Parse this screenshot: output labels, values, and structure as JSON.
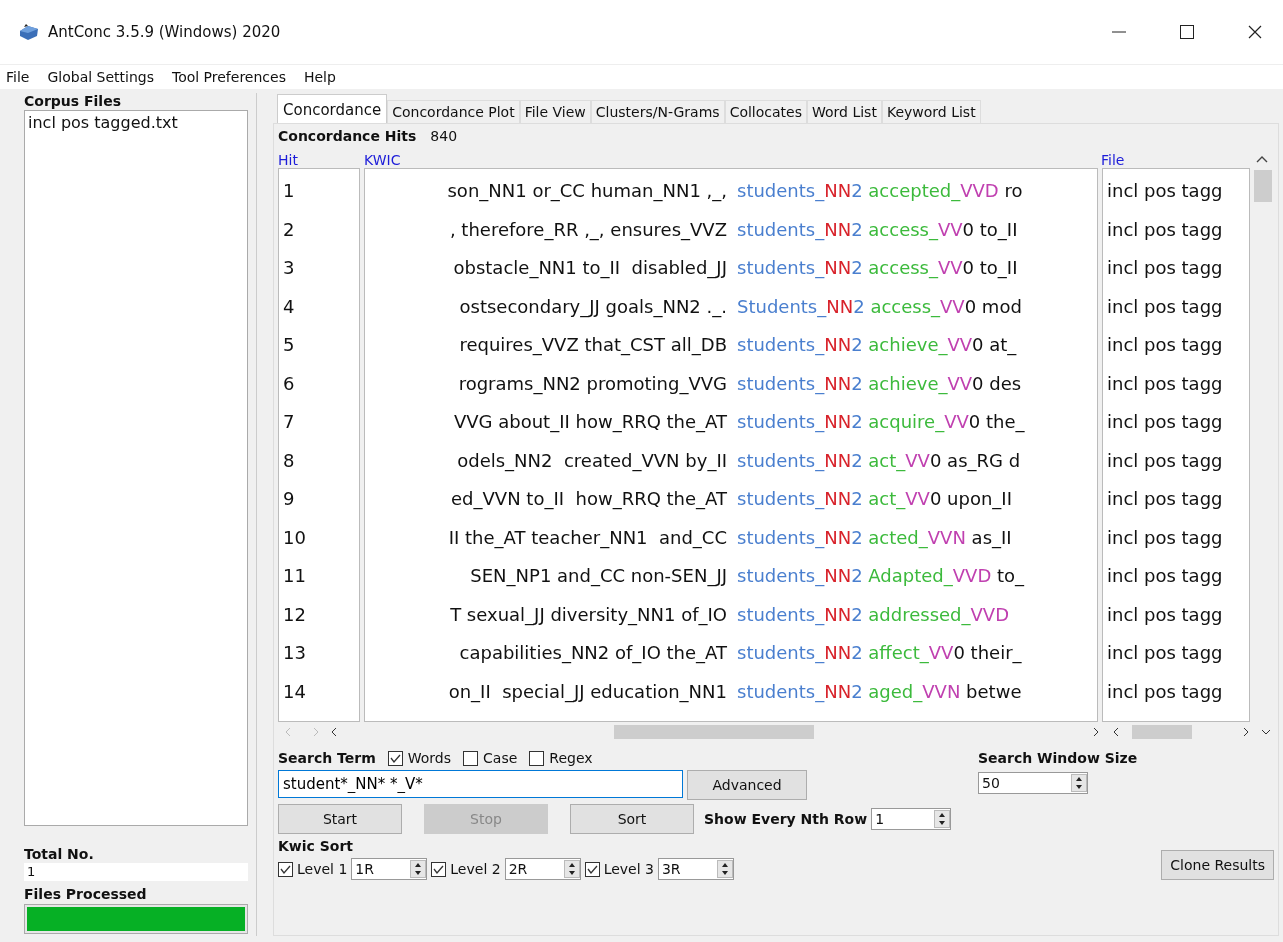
{
  "window": {
    "title": "AntConc 3.5.9 (Windows) 2020"
  },
  "menu": [
    "File",
    "Global Settings",
    "Tool Preferences",
    "Help"
  ],
  "sidebar": {
    "title": "Corpus Files",
    "files": [
      {
        "name": "incl pos tagged.txt",
        "selected": false
      }
    ],
    "total_label": "Total No.",
    "total_value": "1",
    "processed_label": "Files Processed",
    "progress": {
      "level": 1
    }
  },
  "tabs": [
    {
      "label": "Concordance",
      "selected": true
    },
    {
      "label": "Concordance Plot",
      "selected": false
    },
    {
      "label": "File View",
      "selected": false
    },
    {
      "label": "Clusters/N-Grams",
      "selected": false
    },
    {
      "label": "Collocates",
      "selected": false
    },
    {
      "label": "Word List",
      "selected": false
    },
    {
      "label": "Keyword List",
      "selected": false
    }
  ],
  "hits": {
    "label": "Concordance Hits",
    "count": "840"
  },
  "table": {
    "columns": [
      "Hit",
      "KWIC",
      "File"
    ],
    "rows": [
      {
        "hit": "1",
        "left": "son_NN1 or_CC human_NN1 ,_,",
        "node_word": "students_",
        "node_tag": "NN",
        "node_rest": "2",
        "verb_word": "accepted_",
        "verb_tag": "VVD",
        "right": " ro",
        "file": "incl pos tagg"
      },
      {
        "hit": "2",
        "left": ", therefore_RR ,_, ensures_VVZ",
        "node_word": "students_",
        "node_tag": "NN",
        "node_rest": "2",
        "verb_word": "access_",
        "verb_tag": "VV",
        "right": "0 to_II",
        "file": "incl pos tagg"
      },
      {
        "hit": "3",
        "left": "obstacle_NN1 to_II  disabled_JJ",
        "node_word": "students_",
        "node_tag": "NN",
        "node_rest": "2",
        "verb_word": "access_",
        "verb_tag": "VV",
        "right": "0 to_II",
        "file": "incl pos tagg"
      },
      {
        "hit": "4",
        "left": "ostsecondary_JJ goals_NN2 ._.",
        "node_word": "Students_",
        "node_tag": "NN",
        "node_rest": "2",
        "verb_word": "access_",
        "verb_tag": "VV",
        "right": "0 mod",
        "file": "incl pos tagg"
      },
      {
        "hit": "5",
        "left": "requires_VVZ that_CST all_DB",
        "node_word": "students_",
        "node_tag": "NN",
        "node_rest": "2",
        "verb_word": "achieve_",
        "verb_tag": "VV",
        "right": "0 at_",
        "file": "incl pos tagg"
      },
      {
        "hit": "6",
        "left": "rograms_NN2 promoting_VVG",
        "node_word": "students_",
        "node_tag": "NN",
        "node_rest": "2",
        "verb_word": "achieve_",
        "verb_tag": "VV",
        "right": "0 des",
        "file": "incl pos tagg"
      },
      {
        "hit": "7",
        "left": "VVG about_II how_RRQ the_AT",
        "node_word": "students_",
        "node_tag": "NN",
        "node_rest": "2",
        "verb_word": "acquire_",
        "verb_tag": "VV",
        "right": "0 the_",
        "file": "incl pos tagg"
      },
      {
        "hit": "8",
        "left": "odels_NN2  created_VVN by_II",
        "node_word": "students_",
        "node_tag": "NN",
        "node_rest": "2",
        "verb_word": "act_",
        "verb_tag": "VV",
        "right": "0 as_RG d",
        "file": "incl pos tagg"
      },
      {
        "hit": "9",
        "left": "ed_VVN to_II  how_RRQ the_AT",
        "node_word": "students_",
        "node_tag": "NN",
        "node_rest": "2",
        "verb_word": "act_",
        "verb_tag": "VV",
        "right": "0 upon_II",
        "file": "incl pos tagg"
      },
      {
        "hit": "10",
        "left": "II the_AT teacher_NN1  and_CC",
        "node_word": "students_",
        "node_tag": "NN",
        "node_rest": "2",
        "verb_word": "acted_",
        "verb_tag": "VVN",
        "right": " as_II",
        "file": "incl pos tagg"
      },
      {
        "hit": "11",
        "left": "SEN_NP1 and_CC non-SEN_JJ",
        "node_word": "students_",
        "node_tag": "NN",
        "node_rest": "2",
        "verb_word": "Adapted_",
        "verb_tag": "VVD",
        "right": " to_",
        "file": "incl pos tagg"
      },
      {
        "hit": "12",
        "left": "T sexual_JJ diversity_NN1 of_IO",
        "node_word": "students_",
        "node_tag": "NN",
        "node_rest": "2",
        "verb_word": "addressed_",
        "verb_tag": "VVD",
        "file": "incl pos tagg"
      },
      {
        "hit": "13",
        "left": "capabilities_NN2 of_IO the_AT",
        "node_word": "students_",
        "node_tag": "NN",
        "node_rest": "2",
        "verb_word": "affect_",
        "verb_tag": "VV",
        "right": "0 their_",
        "file": "incl pos tagg"
      },
      {
        "hit": "14",
        "left": "on_II  special_JJ education_NN1",
        "node_word": "students_",
        "node_tag": "NN",
        "node_rest": "2",
        "verb_word": "aged_",
        "verb_tag": "VVN",
        "right": " betwe",
        "file": "incl pos tagg"
      }
    ]
  },
  "search": {
    "label": "Search Term",
    "options": [
      {
        "label": "Words",
        "checked": true
      },
      {
        "label": "Case",
        "checked": false
      },
      {
        "label": "Regex",
        "checked": false
      }
    ],
    "value": "student*_NN* *_V*",
    "advanced": "Advanced"
  },
  "buttons": [
    {
      "label": "Start",
      "disabled": false
    },
    {
      "label": "Stop",
      "disabled": true
    },
    {
      "label": "Sort",
      "disabled": false
    }
  ],
  "nth_row": {
    "label": "Show Every Nth Row",
    "value": "1"
  },
  "window_size": {
    "label": "Search Window Size",
    "value": "50"
  },
  "kwic_sort": {
    "label": "Kwic Sort",
    "levels": [
      {
        "label": "Level 1",
        "checked": true,
        "value": "1R"
      },
      {
        "label": "Level 2",
        "checked": true,
        "value": "2R"
      },
      {
        "label": "Level 3",
        "checked": true,
        "value": "3R"
      }
    ]
  },
  "clone": "Clone Results"
}
